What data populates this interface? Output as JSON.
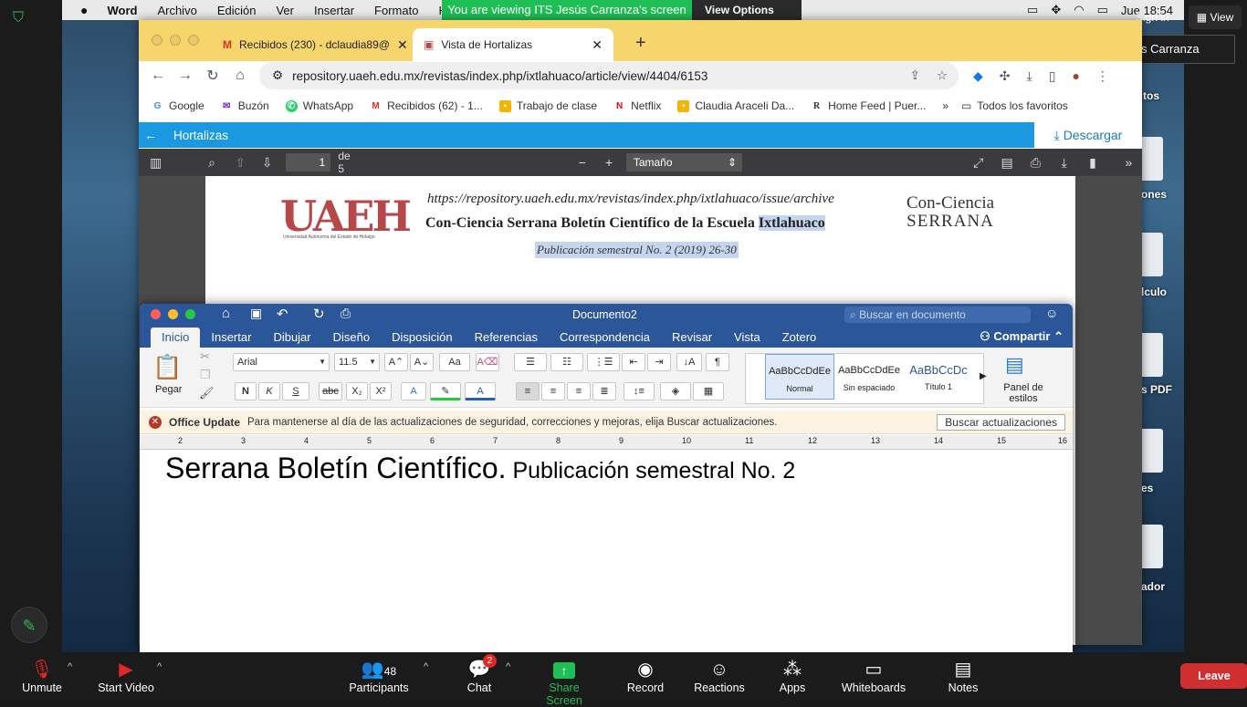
{
  "menubar": {
    "app": "Word",
    "items": [
      "Archivo",
      "Edición",
      "Ver",
      "Insertar",
      "Formato",
      "H"
    ],
    "clock": "Jue 18:54"
  },
  "zoom_banner": {
    "viewing": "You are viewing ITS Jesús Carranza's screen",
    "view_options": "View Options"
  },
  "zoom_top": {
    "signin": "Sign in",
    "view": "View",
    "talking": "Talking: ITS Jesús Carranza"
  },
  "desktop_labels": [
    "tos",
    "ones",
    "lculo",
    "s PDF",
    "es",
    "ador"
  ],
  "chrome": {
    "tabs": [
      {
        "label": "Recibidos (230) - dclaudia89@"
      },
      {
        "label": "Vista de Hortalizas"
      }
    ],
    "url": "repository.uaeh.edu.mx/revistas/index.php/ixtlahuaco/article/view/4404/6153",
    "bookmarks": [
      "Google",
      "Buzón",
      "WhatsApp",
      "Recibidos (62) - 1...",
      "Trabajo de clase",
      "Netflix",
      "Claudia Araceli Da...",
      "Home Feed | Puer..."
    ],
    "all_bookmarks": "Todos los favoritos"
  },
  "pdf": {
    "header_title": "Hortalizas",
    "download": "Descargar",
    "page": "1",
    "page_of": "de 5",
    "zoom": "Tamaño automático",
    "url_text": "https://repository.uaeh.edu.mx/revistas/index.php/ixtlahuaco/issue/archive",
    "title_a": "Con-Ciencia Serrana Boletín Científico de la Escuela ",
    "title_b": "Ixtlahuaco",
    "subtitle": "Publicación semestral No. 2 (2019) 26-30",
    "logo": "UAEH",
    "logo_sub": "Universidad Autónoma del Estado de Hidalgo",
    "cc_logo_1": "Con-Ciencia",
    "cc_logo_2": "SERRANA"
  },
  "word": {
    "title": "Documento2",
    "search_placeholder": "Buscar en documento",
    "tabs": [
      "Inicio",
      "Insertar",
      "Dibujar",
      "Diseño",
      "Disposición",
      "Referencias",
      "Correspondencia",
      "Revisar",
      "Vista",
      "Zotero"
    ],
    "share": "Compartir",
    "paste": "Pegar",
    "font": "Arial",
    "font_size": "11.5",
    "styles": [
      {
        "preview": "AaBbCcDdEe",
        "name": "Normal"
      },
      {
        "preview": "AaBbCcDdEe",
        "name": "Sin espaciado"
      },
      {
        "preview": "AaBbCcDc",
        "name": "Título 1"
      }
    ],
    "styles_panel": "Panel de estilos",
    "update_title": "Office Update",
    "update_msg": "Para mantenerse al día de las actualizaciones de seguridad, correcciones y mejoras, elija Buscar actualizaciones.",
    "update_btn": "Buscar actualizaciones",
    "ruler": [
      "2",
      "3",
      "4",
      "5",
      "6",
      "7",
      "8",
      "9",
      "10",
      "11",
      "12",
      "13",
      "14",
      "15",
      "16"
    ],
    "doc_big": "Serrana Boletín Científico.",
    "doc_small": " Publicación semestral No. 2"
  },
  "controls": {
    "unmute": "Unmute",
    "start_video": "Start Video",
    "participants": "Participants",
    "participants_count": "48",
    "chat": "Chat",
    "chat_badge": "2",
    "share": "Share Screen",
    "record": "Record",
    "reactions": "Reactions",
    "apps": "Apps",
    "whiteboards": "Whiteboards",
    "notes": "Notes",
    "leave": "Leave"
  }
}
